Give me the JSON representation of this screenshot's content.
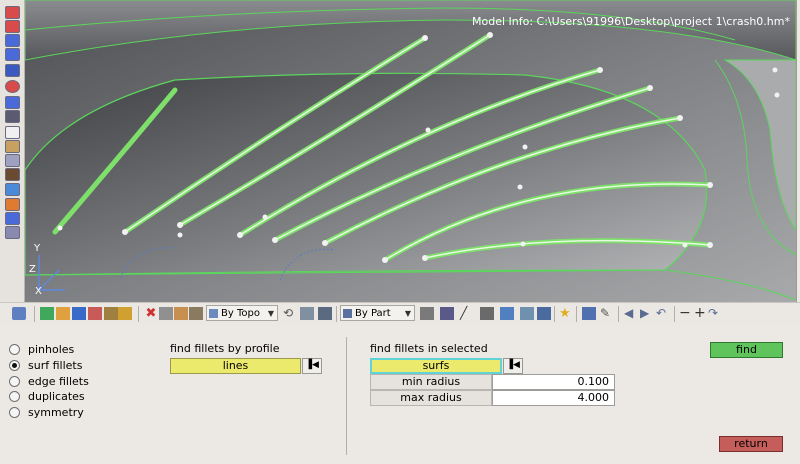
{
  "viewport": {
    "model_info": "Model Info: C:\\Users\\91996\\Desktop\\project 1\\crash0.hm*",
    "axes": {
      "y": "Y",
      "z": "Z",
      "x": "X"
    }
  },
  "left_toolbar": {
    "icons": [
      "display-icon",
      "mask-icon",
      "find-icon",
      "view-icon",
      "shaded-icon",
      "wireframe-icon",
      "ids-icon",
      "count-icon",
      "measure-icon",
      "note-icon",
      "text-icon",
      "element-icon",
      "node-icon",
      "tag-icon",
      "screen-icon",
      "delete-icon"
    ]
  },
  "toolbar": {
    "by_topo": "By Topo",
    "by_part": "By Part"
  },
  "panel": {
    "options": [
      {
        "label": "pinholes",
        "selected": false
      },
      {
        "label": "surf fillets",
        "selected": true
      },
      {
        "label": "edge fillets",
        "selected": false
      },
      {
        "label": "duplicates",
        "selected": false
      },
      {
        "label": "symmetry",
        "selected": false
      }
    ],
    "profile": {
      "heading": "find fillets by profile",
      "collector": "lines"
    },
    "selected": {
      "heading": "find fillets in selected",
      "collector": "surfs",
      "min_radius_label": "min radius",
      "min_radius": "0.100",
      "max_radius_label": "max radius",
      "max_radius": "4.000"
    },
    "find_label": "find",
    "return_label": "return"
  },
  "colors": {
    "accent_green": "#5fc45c",
    "collector_yellow": "#ecea6c",
    "return_red": "#c55e5a",
    "fillet_line": "#7ee06a"
  }
}
